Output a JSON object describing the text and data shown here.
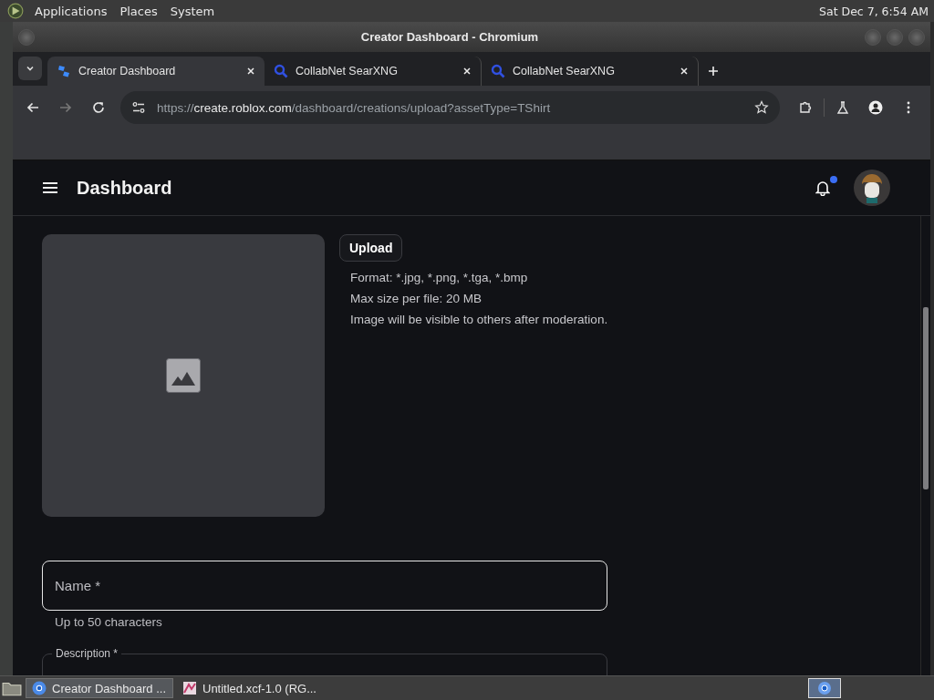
{
  "top_panel": {
    "menus": [
      "Applications",
      "Places",
      "System"
    ],
    "clock": "Sat Dec 7, 6:54 AM"
  },
  "window": {
    "title": "Creator Dashboard - Chromium"
  },
  "tabs": [
    {
      "label": "Creator Dashboard",
      "selected": true,
      "kind": "creator"
    },
    {
      "label": "CollabNet SearXNG",
      "selected": false,
      "kind": "search"
    },
    {
      "label": "CollabNet SearXNG",
      "selected": false,
      "kind": "search"
    }
  ],
  "address_bar": {
    "url_parts": [
      {
        "text": "https://",
        "emphasis": false
      },
      {
        "text": "create.roblox.com",
        "emphasis": true
      },
      {
        "text": "/dashboard/creations/upload?assetType=TShirt",
        "emphasis": false
      }
    ]
  },
  "header": {
    "title": "Dashboard",
    "notifications_unread": true
  },
  "upload": {
    "button": "Upload",
    "notes": [
      "Format: *.jpg, *.png, *.tga, *.bmp",
      "Max size per file: 20 MB",
      "Image will be visible to others after moderation."
    ]
  },
  "name_field": {
    "placeholder": "Name *",
    "helper": "Up to 50 characters"
  },
  "description_field": {
    "label": "Description *"
  },
  "taskbar": {
    "items": [
      {
        "label": "Creator Dashboard ...",
        "selected": true,
        "kind": "browser"
      },
      {
        "label": "Untitled.xcf-1.0 (RG...",
        "selected": false,
        "kind": "image"
      }
    ]
  }
}
